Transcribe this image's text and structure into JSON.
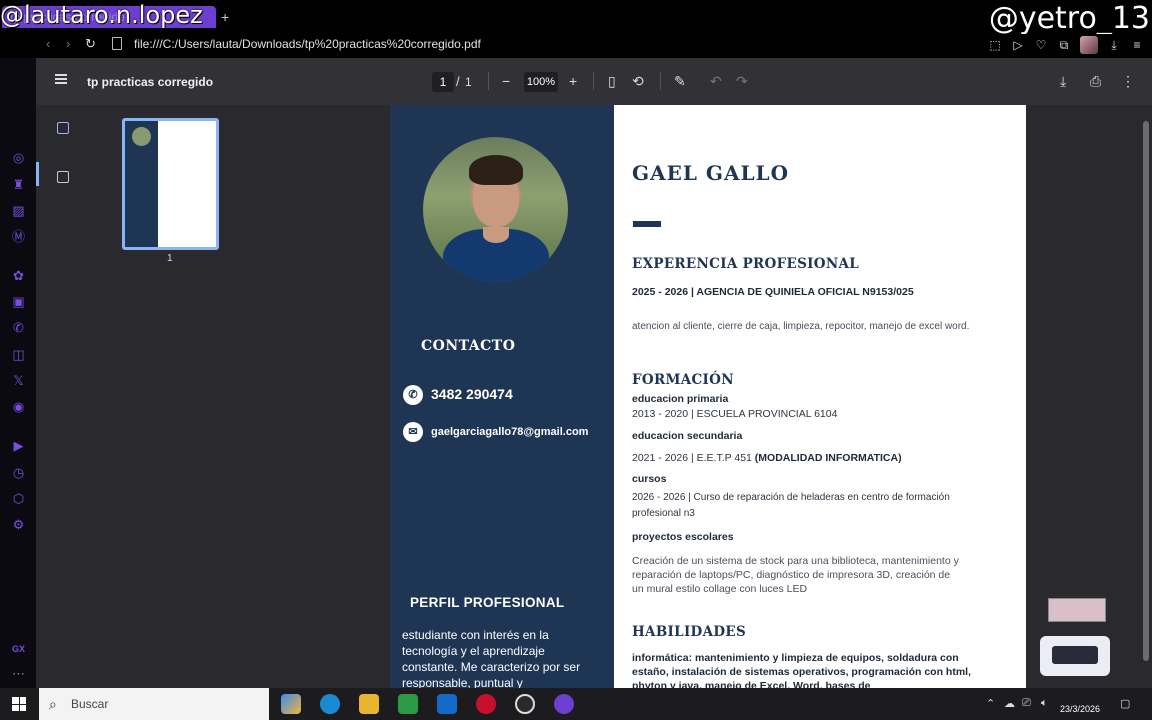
{
  "overlay": {
    "watermark_left": "@lautaro.n.lopez",
    "watermark_right": "@yetro_13"
  },
  "browser": {
    "tab_title": "tp practicas corregido",
    "new_tab": "+",
    "url": "file:///C:/Users/lauta/Downloads/tp%20practicas%20corregido.pdf",
    "accent": "#6d3fd1"
  },
  "sidebar": {
    "label": "GX",
    "icons": [
      "aria-icon",
      "gaming-icon",
      "stripes-icon",
      "messenger-icon",
      "chatgpt-icon",
      "twitch-icon",
      "whatsapp-icon",
      "instagram-icon",
      "x-icon",
      "discord-icon",
      "player-icon",
      "history-icon",
      "extensions-icon",
      "settings-icon"
    ]
  },
  "pdf_toolbar": {
    "title": "tp practicas corregido",
    "page_current": "1",
    "page_sep": "/",
    "page_total": "1",
    "zoom": "100%",
    "zoom_out": "−",
    "zoom_in": "+"
  },
  "thumbnails": {
    "page_label": "1"
  },
  "cv": {
    "name": "GAEL GALLO",
    "contact_heading": "CONTACTO",
    "phone": "3482 290474",
    "email": "gaelgarciagallo78@gmail.com",
    "perfil_heading": "PERFIL PROFESIONAL",
    "perfil_text": "estudiante con interés en la tecnología y el aprendizaje constante. Me caracterizo por ser responsable, puntual y",
    "experiencia_heading": "EXPERENCIA PROFESIONAL",
    "job_title": "2025 - 2026 | AGENCIA DE QUINIELA OFICIAL N9153/025",
    "job_desc": "atencion al cliente, cierre de caja, limpieza, repocitor, manejo de excel word.",
    "formacion_heading": "FORMACIÓN",
    "primaria_label": "educacion primaria",
    "primaria_text": "2013 - 2020 | ESCUELA PROVINCIAL 6104",
    "secundaria_label": "educacion secundaria",
    "secundaria_text": "2021 - 2026 | E.E.T.P 451",
    "secundaria_mod": "(MODALIDAD INFORMATICA)",
    "cursos_label": "cursos",
    "cursos_text": "2026 - 2026 | Curso de reparación de heladeras en centro de formación profesional n3",
    "proyectos_label": "proyectos escolares",
    "proyectos_text": "Creación de un sistema de stock para una biblioteca, mantenimiento y reparación de laptops/PC, diagnóstico de impresora 3D, creación de un mural estilo collage con luces LED",
    "habilidades_heading": "HABILIDADES",
    "habilidades_text": "informática: mantenimiento y limpieza de equipos, soldadura con estaño, instalación de sistemas operativos, programación con html, phyton y java, manejo de Excel, Word, bases de",
    "brand_color": "#1e3553"
  },
  "taskbar": {
    "search_placeholder": "Buscar",
    "date": "23/3/2026"
  }
}
